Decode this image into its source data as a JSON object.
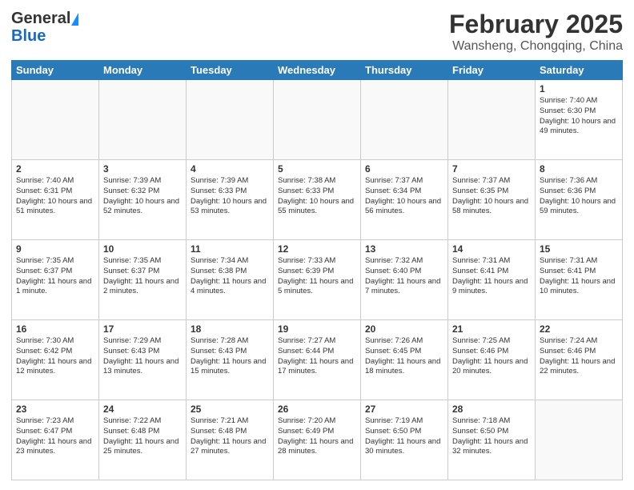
{
  "header": {
    "logo_general": "General",
    "logo_blue": "Blue",
    "title": "February 2025",
    "subtitle": "Wansheng, Chongqing, China"
  },
  "weekdays": [
    "Sunday",
    "Monday",
    "Tuesday",
    "Wednesday",
    "Thursday",
    "Friday",
    "Saturday"
  ],
  "weeks": [
    [
      {
        "day": "",
        "info": ""
      },
      {
        "day": "",
        "info": ""
      },
      {
        "day": "",
        "info": ""
      },
      {
        "day": "",
        "info": ""
      },
      {
        "day": "",
        "info": ""
      },
      {
        "day": "",
        "info": ""
      },
      {
        "day": "1",
        "info": "Sunrise: 7:40 AM\nSunset: 6:30 PM\nDaylight: 10 hours and 49 minutes."
      }
    ],
    [
      {
        "day": "2",
        "info": "Sunrise: 7:40 AM\nSunset: 6:31 PM\nDaylight: 10 hours and 51 minutes."
      },
      {
        "day": "3",
        "info": "Sunrise: 7:39 AM\nSunset: 6:32 PM\nDaylight: 10 hours and 52 minutes."
      },
      {
        "day": "4",
        "info": "Sunrise: 7:39 AM\nSunset: 6:33 PM\nDaylight: 10 hours and 53 minutes."
      },
      {
        "day": "5",
        "info": "Sunrise: 7:38 AM\nSunset: 6:33 PM\nDaylight: 10 hours and 55 minutes."
      },
      {
        "day": "6",
        "info": "Sunrise: 7:37 AM\nSunset: 6:34 PM\nDaylight: 10 hours and 56 minutes."
      },
      {
        "day": "7",
        "info": "Sunrise: 7:37 AM\nSunset: 6:35 PM\nDaylight: 10 hours and 58 minutes."
      },
      {
        "day": "8",
        "info": "Sunrise: 7:36 AM\nSunset: 6:36 PM\nDaylight: 10 hours and 59 minutes."
      }
    ],
    [
      {
        "day": "9",
        "info": "Sunrise: 7:35 AM\nSunset: 6:37 PM\nDaylight: 11 hours and 1 minute."
      },
      {
        "day": "10",
        "info": "Sunrise: 7:35 AM\nSunset: 6:37 PM\nDaylight: 11 hours and 2 minutes."
      },
      {
        "day": "11",
        "info": "Sunrise: 7:34 AM\nSunset: 6:38 PM\nDaylight: 11 hours and 4 minutes."
      },
      {
        "day": "12",
        "info": "Sunrise: 7:33 AM\nSunset: 6:39 PM\nDaylight: 11 hours and 5 minutes."
      },
      {
        "day": "13",
        "info": "Sunrise: 7:32 AM\nSunset: 6:40 PM\nDaylight: 11 hours and 7 minutes."
      },
      {
        "day": "14",
        "info": "Sunrise: 7:31 AM\nSunset: 6:41 PM\nDaylight: 11 hours and 9 minutes."
      },
      {
        "day": "15",
        "info": "Sunrise: 7:31 AM\nSunset: 6:41 PM\nDaylight: 11 hours and 10 minutes."
      }
    ],
    [
      {
        "day": "16",
        "info": "Sunrise: 7:30 AM\nSunset: 6:42 PM\nDaylight: 11 hours and 12 minutes."
      },
      {
        "day": "17",
        "info": "Sunrise: 7:29 AM\nSunset: 6:43 PM\nDaylight: 11 hours and 13 minutes."
      },
      {
        "day": "18",
        "info": "Sunrise: 7:28 AM\nSunset: 6:43 PM\nDaylight: 11 hours and 15 minutes."
      },
      {
        "day": "19",
        "info": "Sunrise: 7:27 AM\nSunset: 6:44 PM\nDaylight: 11 hours and 17 minutes."
      },
      {
        "day": "20",
        "info": "Sunrise: 7:26 AM\nSunset: 6:45 PM\nDaylight: 11 hours and 18 minutes."
      },
      {
        "day": "21",
        "info": "Sunrise: 7:25 AM\nSunset: 6:46 PM\nDaylight: 11 hours and 20 minutes."
      },
      {
        "day": "22",
        "info": "Sunrise: 7:24 AM\nSunset: 6:46 PM\nDaylight: 11 hours and 22 minutes."
      }
    ],
    [
      {
        "day": "23",
        "info": "Sunrise: 7:23 AM\nSunset: 6:47 PM\nDaylight: 11 hours and 23 minutes."
      },
      {
        "day": "24",
        "info": "Sunrise: 7:22 AM\nSunset: 6:48 PM\nDaylight: 11 hours and 25 minutes."
      },
      {
        "day": "25",
        "info": "Sunrise: 7:21 AM\nSunset: 6:48 PM\nDaylight: 11 hours and 27 minutes."
      },
      {
        "day": "26",
        "info": "Sunrise: 7:20 AM\nSunset: 6:49 PM\nDaylight: 11 hours and 28 minutes."
      },
      {
        "day": "27",
        "info": "Sunrise: 7:19 AM\nSunset: 6:50 PM\nDaylight: 11 hours and 30 minutes."
      },
      {
        "day": "28",
        "info": "Sunrise: 7:18 AM\nSunset: 6:50 PM\nDaylight: 11 hours and 32 minutes."
      },
      {
        "day": "",
        "info": ""
      }
    ]
  ]
}
